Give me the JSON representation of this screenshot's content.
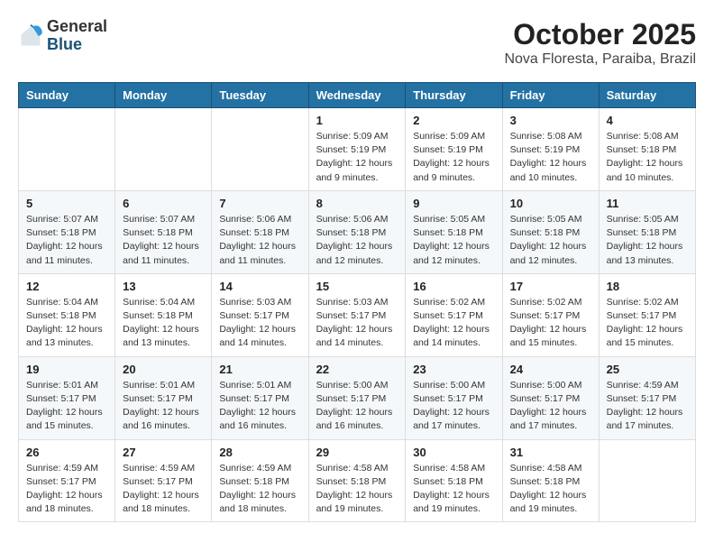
{
  "header": {
    "logo_general": "General",
    "logo_blue": "Blue",
    "month_title": "October 2025",
    "location": "Nova Floresta, Paraiba, Brazil"
  },
  "weekdays": [
    "Sunday",
    "Monday",
    "Tuesday",
    "Wednesday",
    "Thursday",
    "Friday",
    "Saturday"
  ],
  "weeks": [
    [
      {
        "day": "",
        "info": ""
      },
      {
        "day": "",
        "info": ""
      },
      {
        "day": "",
        "info": ""
      },
      {
        "day": "1",
        "info": "Sunrise: 5:09 AM\nSunset: 5:19 PM\nDaylight: 12 hours\nand 9 minutes."
      },
      {
        "day": "2",
        "info": "Sunrise: 5:09 AM\nSunset: 5:19 PM\nDaylight: 12 hours\nand 9 minutes."
      },
      {
        "day": "3",
        "info": "Sunrise: 5:08 AM\nSunset: 5:19 PM\nDaylight: 12 hours\nand 10 minutes."
      },
      {
        "day": "4",
        "info": "Sunrise: 5:08 AM\nSunset: 5:18 PM\nDaylight: 12 hours\nand 10 minutes."
      }
    ],
    [
      {
        "day": "5",
        "info": "Sunrise: 5:07 AM\nSunset: 5:18 PM\nDaylight: 12 hours\nand 11 minutes."
      },
      {
        "day": "6",
        "info": "Sunrise: 5:07 AM\nSunset: 5:18 PM\nDaylight: 12 hours\nand 11 minutes."
      },
      {
        "day": "7",
        "info": "Sunrise: 5:06 AM\nSunset: 5:18 PM\nDaylight: 12 hours\nand 11 minutes."
      },
      {
        "day": "8",
        "info": "Sunrise: 5:06 AM\nSunset: 5:18 PM\nDaylight: 12 hours\nand 12 minutes."
      },
      {
        "day": "9",
        "info": "Sunrise: 5:05 AM\nSunset: 5:18 PM\nDaylight: 12 hours\nand 12 minutes."
      },
      {
        "day": "10",
        "info": "Sunrise: 5:05 AM\nSunset: 5:18 PM\nDaylight: 12 hours\nand 12 minutes."
      },
      {
        "day": "11",
        "info": "Sunrise: 5:05 AM\nSunset: 5:18 PM\nDaylight: 12 hours\nand 13 minutes."
      }
    ],
    [
      {
        "day": "12",
        "info": "Sunrise: 5:04 AM\nSunset: 5:18 PM\nDaylight: 12 hours\nand 13 minutes."
      },
      {
        "day": "13",
        "info": "Sunrise: 5:04 AM\nSunset: 5:18 PM\nDaylight: 12 hours\nand 13 minutes."
      },
      {
        "day": "14",
        "info": "Sunrise: 5:03 AM\nSunset: 5:17 PM\nDaylight: 12 hours\nand 14 minutes."
      },
      {
        "day": "15",
        "info": "Sunrise: 5:03 AM\nSunset: 5:17 PM\nDaylight: 12 hours\nand 14 minutes."
      },
      {
        "day": "16",
        "info": "Sunrise: 5:02 AM\nSunset: 5:17 PM\nDaylight: 12 hours\nand 14 minutes."
      },
      {
        "day": "17",
        "info": "Sunrise: 5:02 AM\nSunset: 5:17 PM\nDaylight: 12 hours\nand 15 minutes."
      },
      {
        "day": "18",
        "info": "Sunrise: 5:02 AM\nSunset: 5:17 PM\nDaylight: 12 hours\nand 15 minutes."
      }
    ],
    [
      {
        "day": "19",
        "info": "Sunrise: 5:01 AM\nSunset: 5:17 PM\nDaylight: 12 hours\nand 15 minutes."
      },
      {
        "day": "20",
        "info": "Sunrise: 5:01 AM\nSunset: 5:17 PM\nDaylight: 12 hours\nand 16 minutes."
      },
      {
        "day": "21",
        "info": "Sunrise: 5:01 AM\nSunset: 5:17 PM\nDaylight: 12 hours\nand 16 minutes."
      },
      {
        "day": "22",
        "info": "Sunrise: 5:00 AM\nSunset: 5:17 PM\nDaylight: 12 hours\nand 16 minutes."
      },
      {
        "day": "23",
        "info": "Sunrise: 5:00 AM\nSunset: 5:17 PM\nDaylight: 12 hours\nand 17 minutes."
      },
      {
        "day": "24",
        "info": "Sunrise: 5:00 AM\nSunset: 5:17 PM\nDaylight: 12 hours\nand 17 minutes."
      },
      {
        "day": "25",
        "info": "Sunrise: 4:59 AM\nSunset: 5:17 PM\nDaylight: 12 hours\nand 17 minutes."
      }
    ],
    [
      {
        "day": "26",
        "info": "Sunrise: 4:59 AM\nSunset: 5:17 PM\nDaylight: 12 hours\nand 18 minutes."
      },
      {
        "day": "27",
        "info": "Sunrise: 4:59 AM\nSunset: 5:17 PM\nDaylight: 12 hours\nand 18 minutes."
      },
      {
        "day": "28",
        "info": "Sunrise: 4:59 AM\nSunset: 5:18 PM\nDaylight: 12 hours\nand 18 minutes."
      },
      {
        "day": "29",
        "info": "Sunrise: 4:58 AM\nSunset: 5:18 PM\nDaylight: 12 hours\nand 19 minutes."
      },
      {
        "day": "30",
        "info": "Sunrise: 4:58 AM\nSunset: 5:18 PM\nDaylight: 12 hours\nand 19 minutes."
      },
      {
        "day": "31",
        "info": "Sunrise: 4:58 AM\nSunset: 5:18 PM\nDaylight: 12 hours\nand 19 minutes."
      },
      {
        "day": "",
        "info": ""
      }
    ]
  ]
}
